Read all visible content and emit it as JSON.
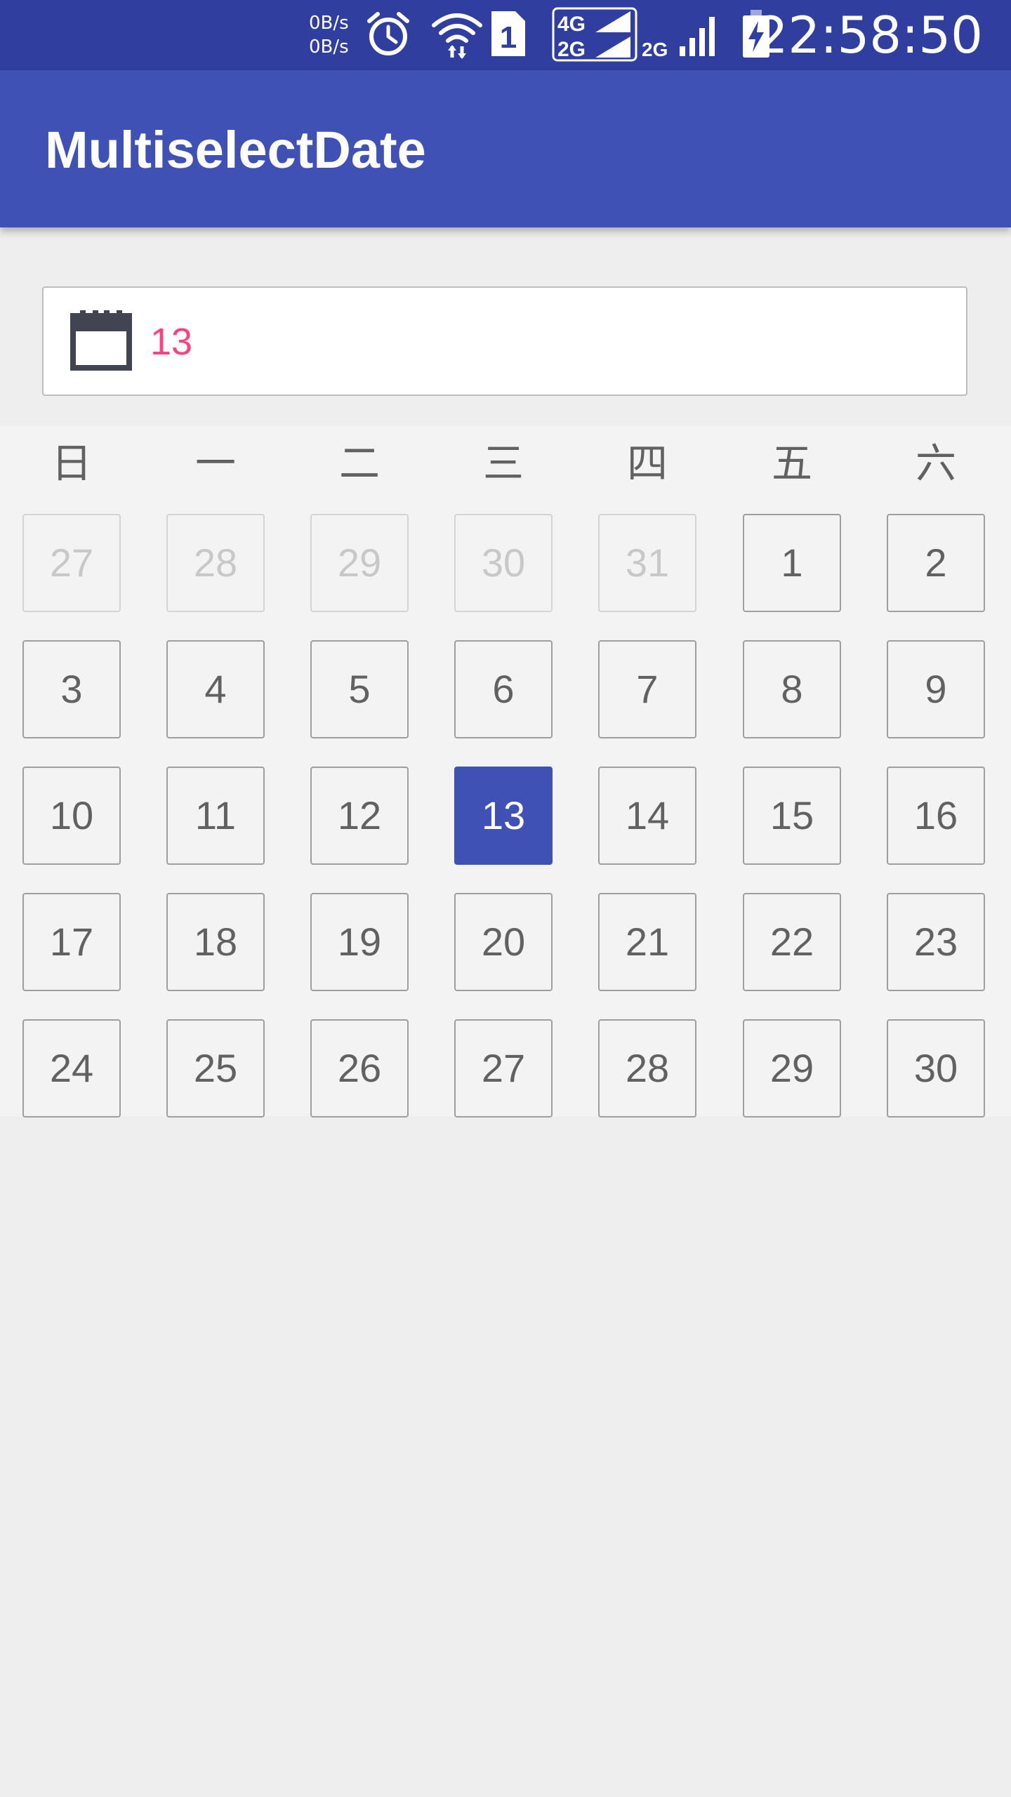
{
  "status_bar": {
    "speed_up": "0B/s",
    "speed_down": "0B/s",
    "network_4g": "4G",
    "network_2g": "2G",
    "network_2g_second": "2G",
    "sim_slot": "1",
    "time": "22:58:50",
    "icons": [
      "alarm-icon",
      "wifi-icon",
      "sim-icon",
      "signal-icon",
      "signal-icon",
      "battery-charging-icon"
    ]
  },
  "app_bar": {
    "title": "MultiselectDate"
  },
  "date_field": {
    "icon": "calendar-icon",
    "value": "13"
  },
  "calendar": {
    "weekdays": [
      "日",
      "一",
      "二",
      "三",
      "四",
      "五",
      "六"
    ],
    "days": [
      {
        "label": "27",
        "state": "other-month"
      },
      {
        "label": "28",
        "state": "other-month"
      },
      {
        "label": "29",
        "state": "other-month"
      },
      {
        "label": "30",
        "state": "other-month"
      },
      {
        "label": "31",
        "state": "other-month"
      },
      {
        "label": "1",
        "state": "normal"
      },
      {
        "label": "2",
        "state": "normal"
      },
      {
        "label": "3",
        "state": "normal"
      },
      {
        "label": "4",
        "state": "normal"
      },
      {
        "label": "5",
        "state": "normal"
      },
      {
        "label": "6",
        "state": "normal"
      },
      {
        "label": "7",
        "state": "normal"
      },
      {
        "label": "8",
        "state": "normal"
      },
      {
        "label": "9",
        "state": "normal"
      },
      {
        "label": "10",
        "state": "normal"
      },
      {
        "label": "11",
        "state": "normal"
      },
      {
        "label": "12",
        "state": "normal"
      },
      {
        "label": "13",
        "state": "selected"
      },
      {
        "label": "14",
        "state": "normal"
      },
      {
        "label": "15",
        "state": "normal"
      },
      {
        "label": "16",
        "state": "normal"
      },
      {
        "label": "17",
        "state": "normal"
      },
      {
        "label": "18",
        "state": "normal"
      },
      {
        "label": "19",
        "state": "normal"
      },
      {
        "label": "20",
        "state": "normal"
      },
      {
        "label": "21",
        "state": "normal"
      },
      {
        "label": "22",
        "state": "normal"
      },
      {
        "label": "23",
        "state": "normal"
      },
      {
        "label": "24",
        "state": "normal"
      },
      {
        "label": "25",
        "state": "normal"
      },
      {
        "label": "26",
        "state": "normal"
      },
      {
        "label": "27",
        "state": "normal"
      },
      {
        "label": "28",
        "state": "normal"
      },
      {
        "label": "29",
        "state": "normal"
      },
      {
        "label": "30",
        "state": "normal"
      }
    ]
  },
  "colors": {
    "status_bar": "#303f9f",
    "app_bar": "#3f51b5",
    "selected_day": "#3f51b5",
    "date_value_text": "#ff4081",
    "day_text": "#616161",
    "muted_day_text": "#c8c8c8"
  }
}
